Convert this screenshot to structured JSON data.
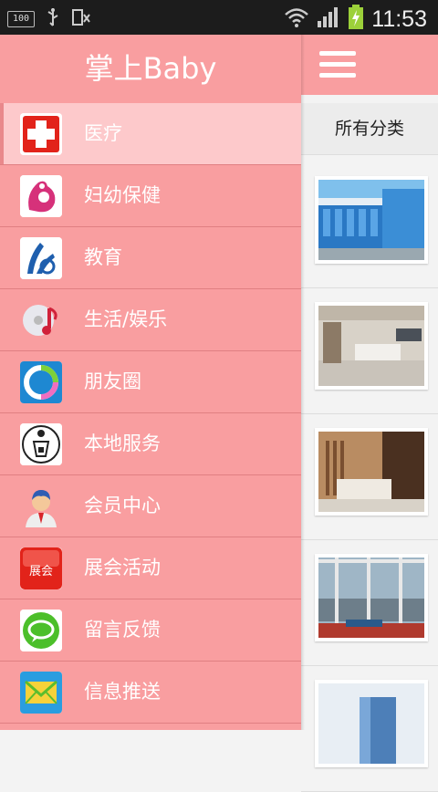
{
  "status_bar": {
    "battery_small": "100",
    "time": "11:53"
  },
  "drawer": {
    "title": "掌上Baby",
    "items": [
      {
        "label": "医疗",
        "icon": "red-cross-icon"
      },
      {
        "label": "妇幼保健",
        "icon": "mother-baby-icon"
      },
      {
        "label": "教育",
        "icon": "education-hands-icon"
      },
      {
        "label": "生活/娱乐",
        "icon": "music-disc-icon"
      },
      {
        "label": "朋友圈",
        "icon": "circle-ring-icon"
      },
      {
        "label": "本地服务",
        "icon": "local-service-icon"
      },
      {
        "label": "会员中心",
        "icon": "member-avatar-icon"
      },
      {
        "label": "展会活动",
        "icon": "exhibition-icon"
      },
      {
        "label": "留言反馈",
        "icon": "speech-bubble-icon"
      },
      {
        "label": "信息推送",
        "icon": "envelope-icon"
      }
    ]
  },
  "content": {
    "category_tab": "所有分类"
  },
  "colors": {
    "accent": "#f99ea0",
    "active": "#fdc9cb",
    "divider": "#e07f82"
  }
}
